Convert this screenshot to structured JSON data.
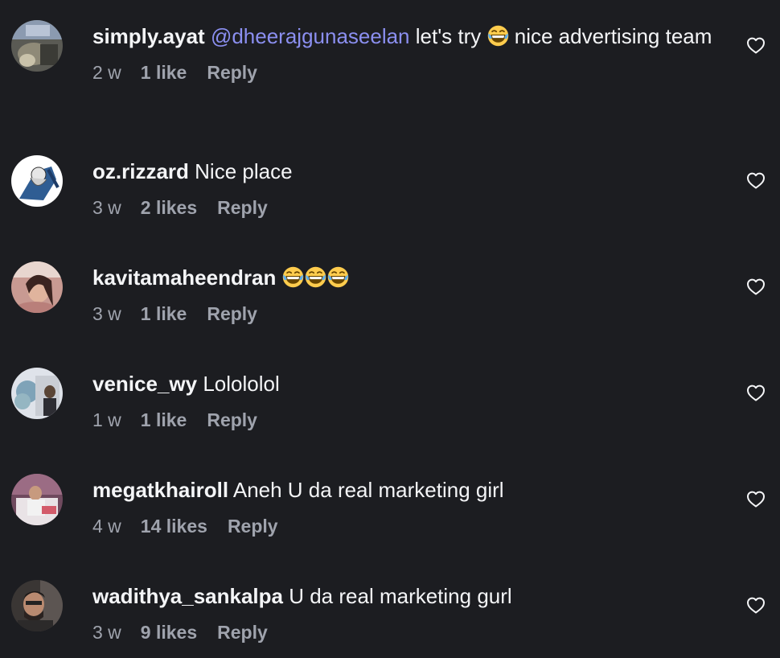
{
  "comments": [
    {
      "username": "simply.ayat",
      "mention": "@dheerajgunaseelan",
      "text_before_emoji": " let's try ",
      "text_after_emoji": " nice advertising team",
      "emoji": "face-with-tears-of-joy",
      "time": "2 w",
      "likes": "1 like",
      "reply": "Reply"
    },
    {
      "username": "oz.rizzard",
      "text": " Nice place",
      "time": "3 w",
      "likes": "2 likes",
      "reply": "Reply"
    },
    {
      "username": "kavitamaheendran",
      "text": " ",
      "emoji": "face-with-tears-of-joy",
      "emoji_count": 3,
      "time": "3 w",
      "likes": "1 like",
      "reply": "Reply"
    },
    {
      "username": "venice_wy",
      "text": " Lolololol",
      "time": "1 w",
      "likes": "1 like",
      "reply": "Reply"
    },
    {
      "username": "megatkhairoll",
      "text": " Aneh U da real marketing girl",
      "time": "4 w",
      "likes": "14 likes",
      "reply": "Reply"
    },
    {
      "username": "wadithya_sankalpa",
      "text": " U da real marketing gurl",
      "time": "3 w",
      "likes": "9 likes",
      "reply": "Reply"
    }
  ],
  "colors": {
    "background": "#1c1d21",
    "text": "#f4f5f7",
    "meta": "#9fa3ad",
    "mention": "#8b8ff0"
  },
  "icons": {
    "like": "heart-outline-icon"
  }
}
